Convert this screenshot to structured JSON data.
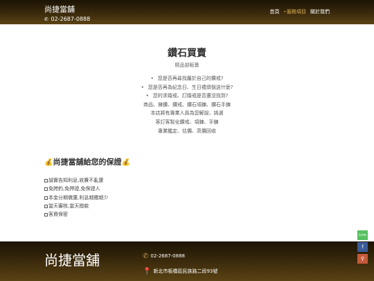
{
  "header": {
    "brand": "尚捷當舖",
    "phone_icon": "phone-icon",
    "phone": "02-2687-0888",
    "nav": [
      {
        "label": "首頁",
        "active": false
      },
      {
        "label": "服務項目",
        "active": true
      },
      {
        "label": "關於我們",
        "active": false
      }
    ]
  },
  "main": {
    "title": "鑽石買賣",
    "subtitle": "精品部販賣",
    "bullets": [
      "您是否再尋找屬於自己的鑽戒?",
      "您是否再為紀念日、生日禮煩惱送什麼?",
      "您的求婚戒、訂婚戒是否還沒找到?"
    ],
    "lines": [
      "商品、擁鑽、鑽戒、鑽石項鍊、鑽石手鍊",
      "本店將有專業人員為您解說、挑選",
      "客訂客製化鑽戒、項鍊、手鍊",
      "專業鑑定、估價、高價回收"
    ]
  },
  "guarantee": {
    "title": "尚捷當舖給您的保證",
    "icon": "money-bag-icon",
    "items": [
      "誠實告知利息,收費不亂還",
      "免跨釣,免押證,免保證人",
      "本金分期償還,利息越繳越少",
      "當天審核,當天撥款",
      "客資保密"
    ]
  },
  "footer": {
    "brand": "尚捷當舖",
    "phone": "02-2687-0888",
    "address": "新北市板橋區民族路二段93號"
  },
  "side_buttons": {
    "line": "Line"
  },
  "colors": {
    "header_bg": "#3b2a0c",
    "nav_active": "#e0b458",
    "line_green": "#57c15f",
    "facebook_blue": "#3b5b98",
    "map_red": "#c55a3a"
  }
}
